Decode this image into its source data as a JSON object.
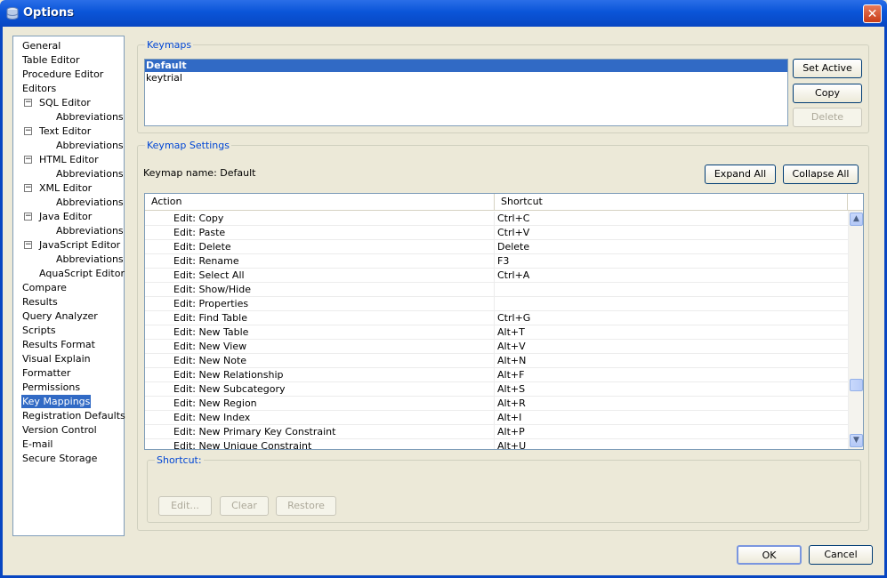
{
  "window": {
    "title": "Options",
    "icon": "database-icon",
    "close_glyph": "✕"
  },
  "nav": {
    "items": [
      {
        "label": "General",
        "level": 0
      },
      {
        "label": "Table Editor",
        "level": 0
      },
      {
        "label": "Procedure Editor",
        "level": 0
      },
      {
        "label": "Editors",
        "level": 0
      },
      {
        "label": "SQL Editor",
        "level": 1,
        "toggle": "⊟"
      },
      {
        "label": "Abbreviations",
        "level": 2
      },
      {
        "label": "Text Editor",
        "level": 1,
        "toggle": "⊟"
      },
      {
        "label": "Abbreviations",
        "level": 2
      },
      {
        "label": "HTML Editor",
        "level": 1,
        "toggle": "⊟"
      },
      {
        "label": "Abbreviations",
        "level": 2
      },
      {
        "label": "XML Editor",
        "level": 1,
        "toggle": "⊟"
      },
      {
        "label": "Abbreviations",
        "level": 2
      },
      {
        "label": "Java Editor",
        "level": 1,
        "toggle": "⊟"
      },
      {
        "label": "Abbreviations",
        "level": 2
      },
      {
        "label": "JavaScript Editor",
        "level": 1,
        "toggle": "⊟"
      },
      {
        "label": "Abbreviations",
        "level": 2
      },
      {
        "label": "AquaScript Editor",
        "level": 1
      },
      {
        "label": "Compare",
        "level": 0
      },
      {
        "label": "Results",
        "level": 0
      },
      {
        "label": "Query Analyzer",
        "level": 0
      },
      {
        "label": "Scripts",
        "level": 0
      },
      {
        "label": "Results Format",
        "level": 0
      },
      {
        "label": "Visual Explain",
        "level": 0
      },
      {
        "label": "Formatter",
        "level": 0
      },
      {
        "label": "Permissions",
        "level": 0
      },
      {
        "label": "Key Mappings",
        "level": 0,
        "selected": true
      },
      {
        "label": "Registration Defaults",
        "level": 0
      },
      {
        "label": "Version Control",
        "level": 0
      },
      {
        "label": "E-mail",
        "level": 0
      },
      {
        "label": "Secure Storage",
        "level": 0
      }
    ]
  },
  "keymaps": {
    "legend": "Keymaps",
    "items": [
      {
        "label": "Default",
        "active": true
      },
      {
        "label": "keytrial",
        "active": false
      }
    ],
    "set_active": "Set Active",
    "copy": "Copy",
    "delete": "Delete"
  },
  "settings": {
    "legend": "Keymap Settings",
    "keymap_name": "Keymap name: Default",
    "expand_all": "Expand All",
    "collapse_all": "Collapse All",
    "columns": [
      "Action",
      "Shortcut"
    ],
    "rows": [
      {
        "action": "Edit: Copy",
        "shortcut": "Ctrl+C"
      },
      {
        "action": "Edit: Paste",
        "shortcut": "Ctrl+V"
      },
      {
        "action": "Edit: Delete",
        "shortcut": "Delete"
      },
      {
        "action": "Edit: Rename",
        "shortcut": "F3"
      },
      {
        "action": "Edit: Select All",
        "shortcut": "Ctrl+A"
      },
      {
        "action": "Edit: Show/Hide",
        "shortcut": ""
      },
      {
        "action": "Edit: Properties",
        "shortcut": ""
      },
      {
        "action": "Edit: Find Table",
        "shortcut": "Ctrl+G"
      },
      {
        "action": "Edit: New Table",
        "shortcut": "Alt+T"
      },
      {
        "action": "Edit: New View",
        "shortcut": "Alt+V"
      },
      {
        "action": "Edit: New Note",
        "shortcut": "Alt+N"
      },
      {
        "action": "Edit: New Relationship",
        "shortcut": "Alt+F"
      },
      {
        "action": "Edit: New Subcategory",
        "shortcut": "Alt+S"
      },
      {
        "action": "Edit: New Region",
        "shortcut": "Alt+R"
      },
      {
        "action": "Edit: New Index",
        "shortcut": "Alt+I"
      },
      {
        "action": "Edit: New Primary Key Constraint",
        "shortcut": "Alt+P"
      },
      {
        "action": "Edit: New Unique Constraint",
        "shortcut": "Alt+U"
      }
    ],
    "scroll_position": 0.78
  },
  "shortcut": {
    "legend": "Shortcut:",
    "edit": "Edit...",
    "clear": "Clear",
    "restore": "Restore"
  },
  "footer": {
    "ok": "OK",
    "cancel": "Cancel"
  }
}
